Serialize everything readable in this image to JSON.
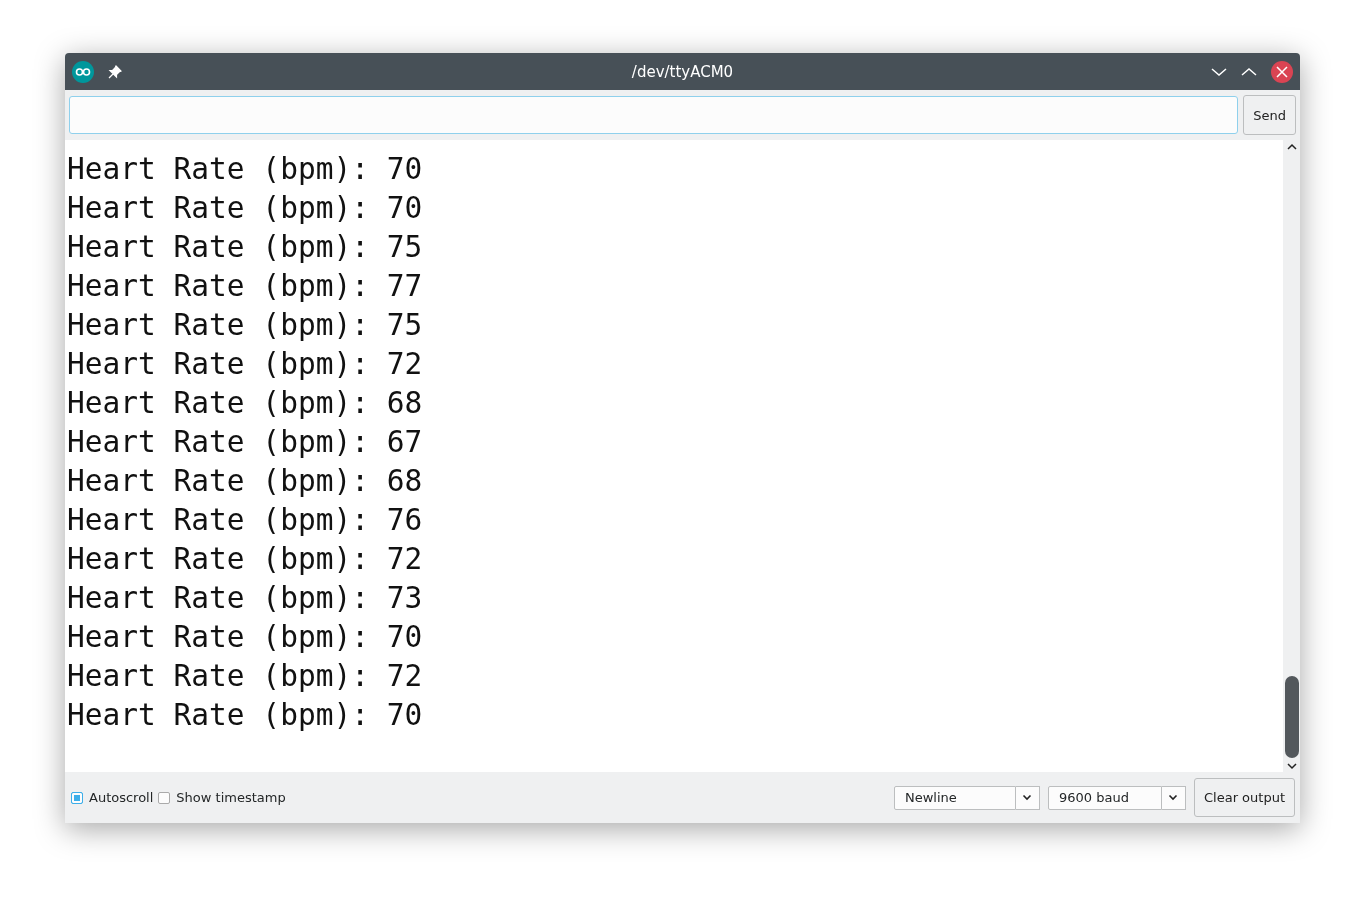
{
  "window": {
    "title": "/dev/ttyACM0"
  },
  "send_button": "Send",
  "output_lines": [
    "Heart Rate (bpm): 70",
    "Heart Rate (bpm): 70",
    "Heart Rate (bpm): 75",
    "Heart Rate (bpm): 77",
    "Heart Rate (bpm): 75",
    "Heart Rate (bpm): 72",
    "Heart Rate (bpm): 68",
    "Heart Rate (bpm): 67",
    "Heart Rate (bpm): 68",
    "Heart Rate (bpm): 76",
    "Heart Rate (bpm): 72",
    "Heart Rate (bpm): 73",
    "Heart Rate (bpm): 70",
    "Heart Rate (bpm): 72",
    "Heart Rate (bpm): 70"
  ],
  "options": [
    {
      "label": "Autoscroll",
      "checked": true
    },
    {
      "label": "Show timestamp",
      "checked": false
    }
  ],
  "dropdowns": [
    {
      "value": "Newline"
    },
    {
      "value": "9600 baud"
    }
  ],
  "clear_button": "Clear output"
}
